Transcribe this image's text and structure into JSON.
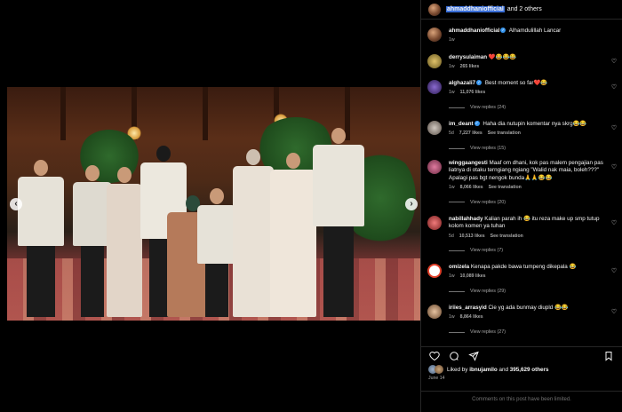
{
  "header": {
    "username": "ahmaddhaniofficial",
    "suffix": "and 2 others"
  },
  "caption": {
    "username": "ahmaddhaniofficial",
    "text": "Alhamdulillah Lancar",
    "time": "1w"
  },
  "comments": [
    {
      "username": "derrysulaiman",
      "verified": false,
      "text": "❤️😂😂😂",
      "time": "1w",
      "likes": "265 likes",
      "translate": "",
      "replies": ""
    },
    {
      "username": "alghazali7",
      "verified": true,
      "text": "Best moment so far❤️😂",
      "time": "1w",
      "likes": "11,076 likes",
      "translate": "",
      "replies": "View replies (24)"
    },
    {
      "username": "im_deant",
      "verified": true,
      "text": "Haha dia nutupin komentar nya skrg😂😂",
      "time": "5d",
      "likes": "7,227 likes",
      "translate": "See translation",
      "replies": "View replies (15)"
    },
    {
      "username": "winggaangesti",
      "verified": false,
      "text": "Maaf om dhani, kok pas malem pengajian pas liatnya di otaku terngiang ngiang \"Walid nak maia, boleh???\" Apalagi pas bgt nengok bunda🙏🙏😂😂",
      "time": "1w",
      "likes": "8,066 likes",
      "translate": "See translation",
      "replies": "View replies (20)"
    },
    {
      "username": "nabillahhady",
      "verified": false,
      "text": "Kalian parah ih 😂 itu reza make up smp tutup kolom komen ya tuhan",
      "time": "5d",
      "likes": "10,513 likes",
      "translate": "See translation",
      "replies": "View replies (7)"
    },
    {
      "username": "omizela",
      "verified": false,
      "text": "Kenapa pakde bawa tumpeng dikepala 😂",
      "time": "1w",
      "likes": "10,089 likes",
      "translate": "",
      "replies": "View replies (29)"
    },
    {
      "username": "iriies_arrasyid",
      "verified": false,
      "text": "Cie yg ada bunmay diupld 😂😂",
      "time": "1w",
      "likes": "8,864 likes",
      "translate": "",
      "replies": "View replies (27)"
    }
  ],
  "likes": {
    "prefix": "Liked by",
    "user": "ibnujamilo",
    "joiner": "and",
    "count": "395,629 others"
  },
  "date": "June 14",
  "footer": {
    "limited_text": "Comments on this post have been limited."
  },
  "icons": {
    "heart": "heart-icon",
    "comment": "comment-icon",
    "share": "share-icon",
    "bookmark": "bookmark-icon",
    "prev": "chevron-left-icon",
    "next": "chevron-right-icon"
  },
  "colors": {
    "accent_verified": "#3897f0",
    "background": "#000000",
    "muted": "#a8a8a8",
    "highlight": "#3a6fd8"
  }
}
